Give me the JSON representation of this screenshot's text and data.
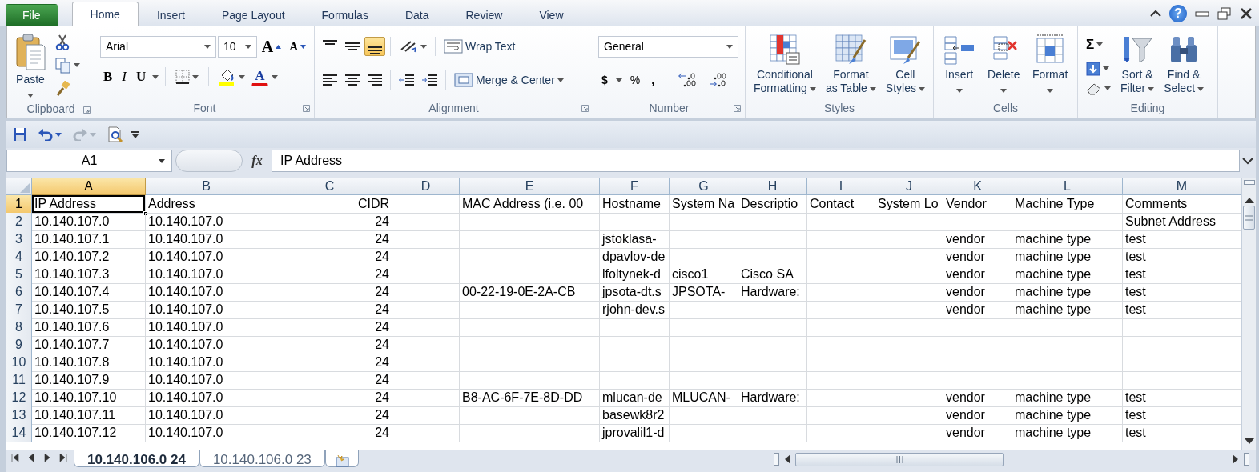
{
  "ribbon_tabs": [
    {
      "label": "File",
      "kind": "file",
      "selected": false
    },
    {
      "label": "Home",
      "kind": "tab",
      "selected": true
    },
    {
      "label": "Insert",
      "kind": "tab",
      "selected": false
    },
    {
      "label": "Page Layout",
      "kind": "tab",
      "selected": false
    },
    {
      "label": "Formulas",
      "kind": "tab",
      "selected": false
    },
    {
      "label": "Data",
      "kind": "tab",
      "selected": false
    },
    {
      "label": "Review",
      "kind": "tab",
      "selected": false
    },
    {
      "label": "View",
      "kind": "tab",
      "selected": false
    }
  ],
  "window_controls": {
    "help": "?"
  },
  "clipboard": {
    "paste": "Paste",
    "label": "Clipboard"
  },
  "font": {
    "name": "Arial",
    "size": "10",
    "grow": "A",
    "shrink": "A",
    "bold": "B",
    "italic": "I",
    "underline": "U",
    "font_color": "A",
    "label": "Font"
  },
  "alignment": {
    "vertical_align": [
      {
        "selected": false
      },
      {
        "selected": false
      },
      {
        "selected": true
      }
    ],
    "wrap_text": "Wrap Text",
    "merge": "Merge & Center",
    "label": "Alignment"
  },
  "number": {
    "format": "General",
    "currency": "$",
    "percent": "%",
    "comma": ",",
    "label": "Number"
  },
  "styles": {
    "buttons": [
      {
        "kind": "conditional",
        "lines": [
          "Conditional",
          "Formatting"
        ]
      },
      {
        "kind": "table",
        "lines": [
          "Format",
          "as Table"
        ]
      },
      {
        "kind": "cellstyles",
        "lines": [
          "Cell",
          "Styles"
        ]
      }
    ],
    "label": "Styles"
  },
  "cells": {
    "buttons": [
      {
        "kind": "insert",
        "lines": [
          "Insert"
        ]
      },
      {
        "kind": "delete",
        "lines": [
          "Delete"
        ]
      },
      {
        "kind": "format",
        "lines": [
          "Format"
        ]
      }
    ],
    "label": "Cells"
  },
  "editing": {
    "sum": "Σ",
    "buttons": [
      {
        "kind": "sort",
        "lines": [
          "Sort &",
          "Filter"
        ]
      },
      {
        "kind": "find",
        "lines": [
          "Find &",
          "Select"
        ]
      }
    ],
    "label": "Editing"
  },
  "quick_access": [
    {
      "kind": "save",
      "disabled": false
    },
    {
      "kind": "undo",
      "disabled": false
    },
    {
      "kind": "redo",
      "disabled": true
    },
    {
      "kind": "preview",
      "disabled": false
    }
  ],
  "formula_bar": {
    "name_box": "A1",
    "fx": "fx",
    "formula": "IP Address"
  },
  "sheet": {
    "columns": [
      {
        "letter": "A",
        "kind": "text",
        "selected": true
      },
      {
        "letter": "B",
        "kind": "text",
        "selected": false
      },
      {
        "letter": "C",
        "kind": "number",
        "selected": false
      },
      {
        "letter": "D",
        "kind": "text",
        "selected": false
      },
      {
        "letter": "E",
        "kind": "text",
        "selected": false
      },
      {
        "letter": "F",
        "kind": "text",
        "selected": false
      },
      {
        "letter": "G",
        "kind": "text",
        "selected": false
      },
      {
        "letter": "H",
        "kind": "text",
        "selected": false
      },
      {
        "letter": "I",
        "kind": "text",
        "selected": false
      },
      {
        "letter": "J",
        "kind": "text",
        "selected": false
      },
      {
        "letter": "K",
        "kind": "text",
        "selected": false
      },
      {
        "letter": "L",
        "kind": "text",
        "selected": false
      },
      {
        "letter": "M",
        "kind": "text",
        "selected": false
      }
    ],
    "rows": [
      {
        "number": "1",
        "selected": true,
        "cells": [
          "IP Address",
          "Address",
          "CIDR",
          null,
          "MAC Address (i.e. 00",
          "Hostname",
          "System Na",
          "Descriptio",
          "Contact",
          "System Lo",
          "Vendor",
          "Machine Type",
          "Comments"
        ]
      },
      {
        "number": "2",
        "selected": false,
        "cells": [
          "10.140.107.0",
          "10.140.107.0",
          "24",
          null,
          null,
          null,
          null,
          null,
          null,
          null,
          null,
          null,
          "Subnet Address"
        ]
      },
      {
        "number": "3",
        "selected": false,
        "cells": [
          "10.140.107.1",
          "10.140.107.0",
          "24",
          null,
          null,
          "jstoklasa-",
          null,
          null,
          null,
          null,
          "vendor",
          "machine type",
          "test"
        ]
      },
      {
        "number": "4",
        "selected": false,
        "cells": [
          "10.140.107.2",
          "10.140.107.0",
          "24",
          null,
          null,
          "dpavlov-de",
          null,
          null,
          null,
          null,
          "vendor",
          "machine type",
          "test"
        ]
      },
      {
        "number": "5",
        "selected": false,
        "cells": [
          "10.140.107.3",
          "10.140.107.0",
          "24",
          null,
          null,
          "lfoltynek-d",
          "cisco1",
          "Cisco SA",
          null,
          null,
          "vendor",
          "machine type",
          "test"
        ]
      },
      {
        "number": "6",
        "selected": false,
        "cells": [
          "10.140.107.4",
          "10.140.107.0",
          "24",
          null,
          "00-22-19-0E-2A-CB",
          "jpsota-dt.s",
          "JPSOTA-",
          "Hardware:",
          null,
          null,
          "vendor",
          "machine type",
          "test"
        ]
      },
      {
        "number": "7",
        "selected": false,
        "cells": [
          "10.140.107.5",
          "10.140.107.0",
          "24",
          null,
          null,
          "rjohn-dev.s",
          null,
          null,
          null,
          null,
          "vendor",
          "machine type",
          "test"
        ]
      },
      {
        "number": "8",
        "selected": false,
        "cells": [
          "10.140.107.6",
          "10.140.107.0",
          "24",
          null,
          null,
          null,
          null,
          null,
          null,
          null,
          null,
          null,
          null
        ]
      },
      {
        "number": "9",
        "selected": false,
        "cells": [
          "10.140.107.7",
          "10.140.107.0",
          "24",
          null,
          null,
          null,
          null,
          null,
          null,
          null,
          null,
          null,
          null
        ]
      },
      {
        "number": "10",
        "selected": false,
        "cells": [
          "10.140.107.8",
          "10.140.107.0",
          "24",
          null,
          null,
          null,
          null,
          null,
          null,
          null,
          null,
          null,
          null
        ]
      },
      {
        "number": "11",
        "selected": false,
        "cells": [
          "10.140.107.9",
          "10.140.107.0",
          "24",
          null,
          null,
          null,
          null,
          null,
          null,
          null,
          null,
          null,
          null
        ]
      },
      {
        "number": "12",
        "selected": false,
        "cells": [
          "10.140.107.10",
          "10.140.107.0",
          "24",
          null,
          "B8-AC-6F-7E-8D-DD",
          "mlucan-de",
          "MLUCAN-",
          "Hardware:",
          null,
          null,
          "vendor",
          "machine type",
          "test"
        ]
      },
      {
        "number": "13",
        "selected": false,
        "cells": [
          "10.140.107.11",
          "10.140.107.0",
          "24",
          null,
          null,
          "basewk8r2",
          null,
          null,
          null,
          null,
          "vendor",
          "machine type",
          "test"
        ]
      },
      {
        "number": "14",
        "selected": false,
        "cells": [
          "10.140.107.12",
          "10.140.107.0",
          "24",
          null,
          null,
          "jprovalil1-d",
          null,
          null,
          null,
          null,
          "vendor",
          "machine type",
          "test"
        ]
      }
    ]
  },
  "sheet_tabs": [
    {
      "label": "10.140.106.0 24",
      "selected": true
    },
    {
      "label": "10.140.106.0 23",
      "selected": false
    }
  ]
}
